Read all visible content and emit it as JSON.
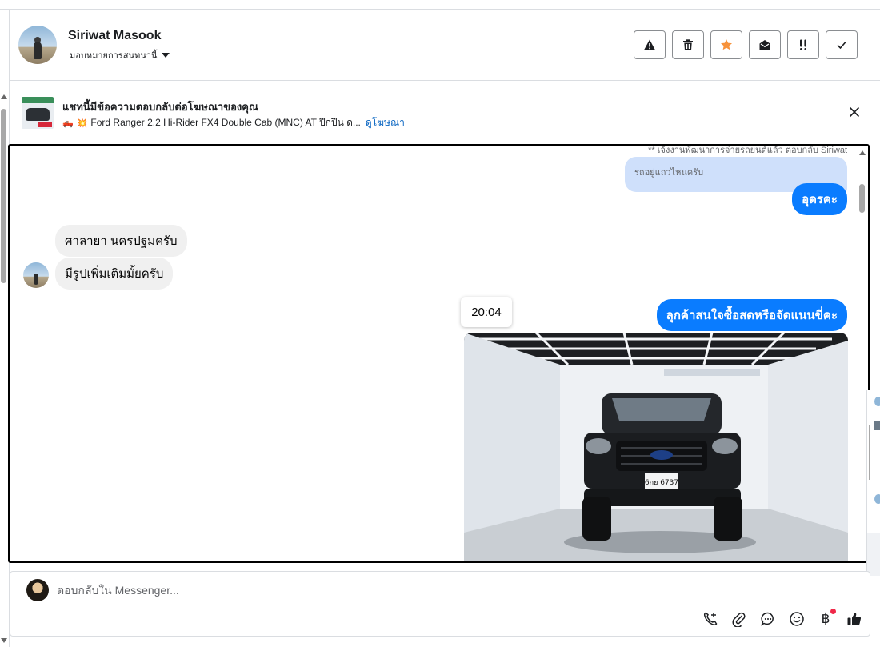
{
  "header": {
    "contact_name": "Siriwat Masook",
    "assign_label": "มอบหมายการสนทนานี้",
    "actions": [
      {
        "name": "report-spam",
        "icon": "warning-icon"
      },
      {
        "name": "delete",
        "icon": "trash-icon"
      },
      {
        "name": "follow-up",
        "icon": "star-icon"
      },
      {
        "name": "mark-unread",
        "icon": "envelope-open-icon"
      },
      {
        "name": "priority",
        "icon": "exclamation-icon"
      },
      {
        "name": "mark-done",
        "icon": "check-icon"
      }
    ],
    "star_color": "#f7923b"
  },
  "banner": {
    "title": "แชทนี้มีข้อความตอบกลับต่อโฆษณาของคุณ",
    "ad_text": "Ford Ranger 2.2 Hi-Rider FX4 Double Cab (MNC) AT ปีกปืน ด...",
    "view_ad_label": "ดูโฆษณา",
    "emojis": [
      "🛻",
      "💥"
    ]
  },
  "conversation": {
    "cut_off_text": "** เจ้งงานพัฒนาการจ่ายรถยนต์แล้ว ตอบกลับ Siriwat",
    "quoted_reply": "รถอยู่แถวไหนครับ",
    "messages": [
      {
        "direction": "out",
        "text": "อุดรคะ"
      },
      {
        "direction": "in",
        "text": "ศาลายา นครปฐมครับ"
      },
      {
        "direction": "in",
        "text": "มีรูปเพิ่มเติมมั้ยครับ"
      },
      {
        "direction": "out",
        "text": "ลุกค้าสนใจซื้อสดหรือจัดแนนขี่คะ"
      }
    ],
    "timestamp_tooltip": "20:04",
    "photo": {
      "subject": "black Ford Ranger front view in showroom",
      "plate": "6กย 6737"
    },
    "outgoing_color": "#0a7cff",
    "incoming_color": "#f0f0f0"
  },
  "composer": {
    "placeholder": "ตอบกลับใน Messenger...",
    "tools": [
      {
        "name": "call-icon"
      },
      {
        "name": "attachment-icon"
      },
      {
        "name": "saved-replies-icon"
      },
      {
        "name": "emoji-icon"
      },
      {
        "name": "payment-icon",
        "glyph": "฿",
        "has_notification": true
      },
      {
        "name": "like-icon"
      }
    ]
  }
}
